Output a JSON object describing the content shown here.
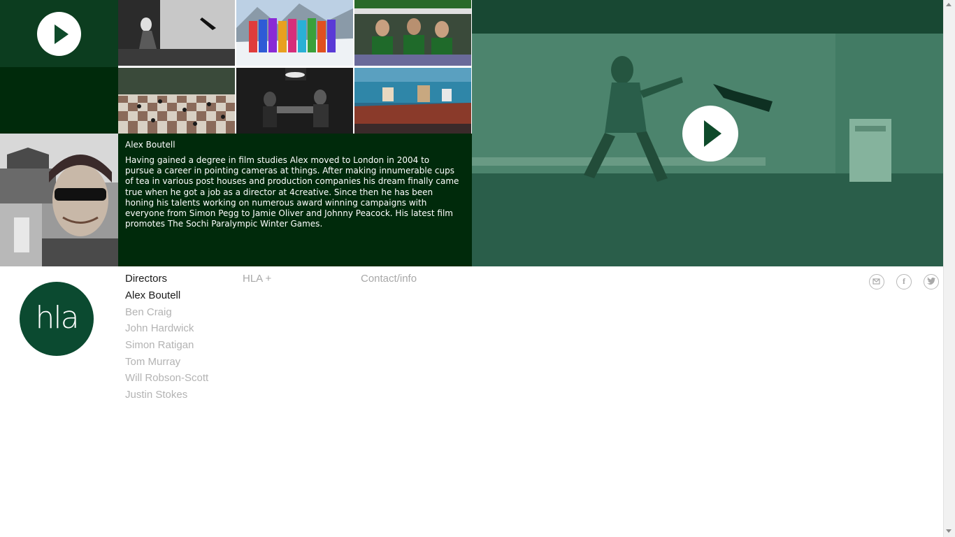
{
  "hero": {
    "thumbnails": [
      {
        "name": "thumb-studio-throw"
      },
      {
        "name": "thumb-ski-team"
      },
      {
        "name": "thumb-bus-passengers"
      },
      {
        "name": "thumb-checkered-dancers"
      },
      {
        "name": "thumb-dark-dinner"
      },
      {
        "name": "thumb-colorful-boat"
      }
    ],
    "play_icon": "play-icon",
    "colors": {
      "dark_green": "#002a0b",
      "tile_green": "#0c3d1f",
      "video_tint": "#3f7a63"
    }
  },
  "bio": {
    "name": "Alex Boutell",
    "text": "Having gained a degree in film studies Alex moved to London in 2004 to pursue a career in pointing cameras at things. After making innumerable cups of tea in various post houses and production companies his dream finally came true when he got a job as a director at 4creative. Since then he has been honing his talents working on numerous award winning campaigns with everyone from Simon Pegg to Jamie Oliver and Johnny Peacock. His latest film promotes The Sochi Paralympic Winter Games."
  },
  "logo": {
    "text": "hla",
    "color": "#0b4a30"
  },
  "nav": {
    "directors": "Directors",
    "hla_plus": "HLA +",
    "contact": "Contact/info"
  },
  "directors": [
    {
      "name": "Alex Boutell",
      "active": true
    },
    {
      "name": "Ben Craig",
      "active": false
    },
    {
      "name": "John Hardwick",
      "active": false
    },
    {
      "name": "Simon Ratigan",
      "active": false
    },
    {
      "name": "Tom Murray",
      "active": false
    },
    {
      "name": "Will Robson-Scott",
      "active": false
    },
    {
      "name": "Justin Stokes",
      "active": false
    }
  ],
  "social_icons": [
    "email-icon",
    "facebook-icon",
    "twitter-icon"
  ]
}
